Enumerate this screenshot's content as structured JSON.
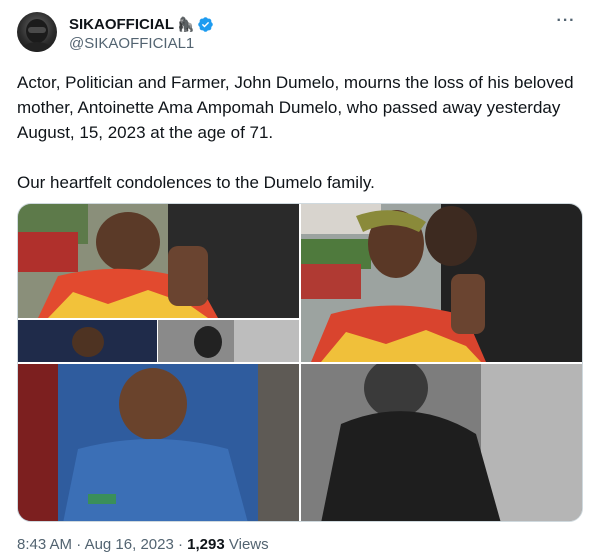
{
  "author": {
    "display_name": "SIKAOFFICIAL",
    "emoji": "🦍",
    "verified": true,
    "handle": "@SIKAOFFICIAL1",
    "avatar_icon": "avatar-motorcycle-helmet"
  },
  "menu": {
    "icon": "more-horizontal-icon",
    "glyph": "···"
  },
  "tweet": {
    "paragraphs": [
      "Actor, Politician and Farmer, John Dumelo, mourns the loss of his beloved mother, Antoinette Ama Ampomah Dumelo, who passed away yesterday August, 15, 2023 at the age of 71.",
      "Our heartfelt condolences to the Dumelo family."
    ]
  },
  "media": {
    "images": [
      {
        "name": "collage-photo",
        "description": ""
      },
      {
        "name": "kiss-photo"
      },
      {
        "name": "uniform-photo"
      },
      {
        "name": "bw-portrait-photo"
      }
    ]
  },
  "meta": {
    "time": "8:43 AM",
    "separator": " · ",
    "date": "Aug 16, 2023",
    "views_count": "1,293",
    "views_label": "Views"
  },
  "colors": {
    "verified_blue": "#1d9bf0",
    "secondary_text": "#536471",
    "primary_text": "#0f1419",
    "border": "#cfd9de"
  }
}
